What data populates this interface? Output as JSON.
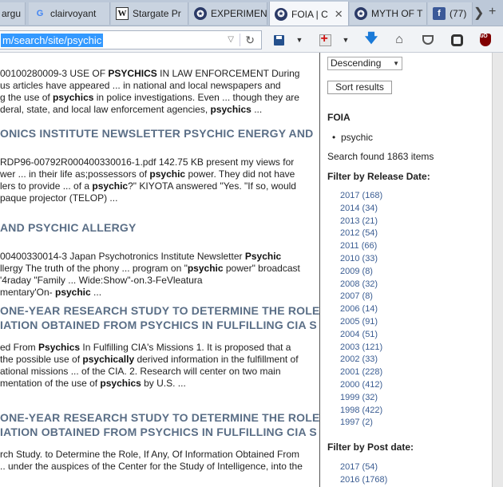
{
  "tabs": [
    {
      "label": "argu",
      "icon": "cia-seal-icon"
    },
    {
      "label": "clairvoyant",
      "icon": "google-icon"
    },
    {
      "label": "Stargate Pr",
      "icon": "wikipedia-icon"
    },
    {
      "label": "EXPERIMEN",
      "icon": "cia-seal-icon"
    },
    {
      "label": "FOIA | C",
      "icon": "cia-seal-icon",
      "active": true
    },
    {
      "label": "MYTH OF T",
      "icon": "cia-seal-icon"
    },
    {
      "label": "(77)",
      "icon": "facebook-icon"
    }
  ],
  "tab_controls": {
    "scroll_right": "❯",
    "new_tab": "+"
  },
  "address_bar": {
    "url": "m/search/site/psychic"
  },
  "results": [
    {
      "lines": [
        [
          [
            "00100280009-3 USE OF ",
            false
          ],
          [
            "PSYCHICS",
            true
          ],
          [
            " IN LAW ENFORCEMENT During",
            false
          ]
        ],
        [
          [
            "us articles have appeared ... in national and local newspapers and",
            false
          ]
        ],
        [
          [
            "g the use of ",
            false
          ],
          [
            "psychics",
            true
          ],
          [
            " in police investigations. Even ... though they are",
            false
          ]
        ],
        [
          [
            "deral, state, and local law enforcement agencies, ",
            false
          ],
          [
            "psychics",
            true
          ],
          [
            " ...",
            false
          ]
        ]
      ]
    },
    {
      "title": [
        "ONICS INSTITUTE NEWSLETTER PSYCHIC ENERGY AND"
      ],
      "lines": [
        [
          [
            "RDP96-00792R000400330016-1.pdf 142.75 KB present my views for",
            false
          ]
        ],
        [
          [
            "wer ... in their life as;possessors of ",
            false
          ],
          [
            "psychic",
            true
          ],
          [
            " power. They did not have",
            false
          ]
        ],
        [
          [
            "lers to provide ... of a ",
            false
          ],
          [
            "psychic",
            true
          ],
          [
            "?\" KIYOTA answered \"Yes. \"If so, would",
            false
          ]
        ],
        [
          [
            "paque projector (TELOP) ...",
            false
          ]
        ]
      ]
    },
    {
      "title": [
        "AND PSYCHIC ALLERGY"
      ],
      "lines": [
        [
          [
            "00400330014-3 Japan Psychotronics Institute Newsletter ",
            false
          ],
          [
            "Psychic",
            true
          ]
        ],
        [
          [
            "llergy The truth of the phony ... program on \"",
            false
          ],
          [
            "psychic",
            true
          ],
          [
            " power\" broadcast",
            false
          ]
        ],
        [
          [
            "'4raday \"Family ... Wide:Show\"-on.3-FeVleatura",
            false
          ]
        ],
        [
          [
            "mentary'On- ",
            false
          ],
          [
            "psychic",
            true
          ],
          [
            " ...",
            false
          ]
        ]
      ]
    },
    {
      "title": [
        "ONE-YEAR RESEARCH STUDY TO DETERMINE THE ROLE,",
        "IATION OBTAINED FROM PSYCHICS IN FULFILLING CIA S"
      ],
      "lines": [
        [
          [
            "ed From ",
            false
          ],
          [
            "Psychics",
            true
          ],
          [
            " In Fulfilling CIA's Missions 1. It is proposed that a",
            false
          ]
        ],
        [
          [
            " the possible use of ",
            false
          ],
          [
            "psychically",
            true
          ],
          [
            " derived information in the fulfillment of",
            false
          ]
        ],
        [
          [
            "ational missions ... of the CIA. 2. Research will center on two main",
            false
          ]
        ],
        [
          [
            "mentation of the use of ",
            false
          ],
          [
            "psychics",
            true
          ],
          [
            " by U.S. ...",
            false
          ]
        ]
      ]
    },
    {
      "title": [
        "ONE-YEAR RESEARCH STUDY TO DETERMINE THE ROLE,",
        "IATION OBTAINED FROM PSYCHICS IN FULFILLING CIA S"
      ],
      "lines": [
        [
          [
            "rch Study. to Determine the Role, If Any, Of Information Obtained From",
            false
          ]
        ],
        [
          [
            " .. under the auspices of the Center for the Study of Intelligence, into the",
            false
          ]
        ]
      ]
    }
  ],
  "sidebar": {
    "sort_value": "Descending",
    "sort_button": "Sort results",
    "section_title": "FOIA",
    "filter_term": "psychic",
    "found_text": "Search found 1863 items",
    "release_heading": "Filter by Release Date:",
    "release_dates": [
      "2017 (168)",
      "2014 (34)",
      "2013 (21)",
      "2012 (54)",
      "2011 (66)",
      "2010 (33)",
      "2009 (8)",
      "2008 (32)",
      "2007 (8)",
      "2006 (14)",
      "2005 (91)",
      "2004 (51)",
      "2003 (121)",
      "2002 (33)",
      "2001 (228)",
      "2000 (412)",
      "1999 (32)",
      "1998 (422)",
      "1997 (2)"
    ],
    "post_heading": "Filter by Post date:",
    "post_dates": [
      "2017 (54)",
      "2016 (1768)"
    ]
  }
}
